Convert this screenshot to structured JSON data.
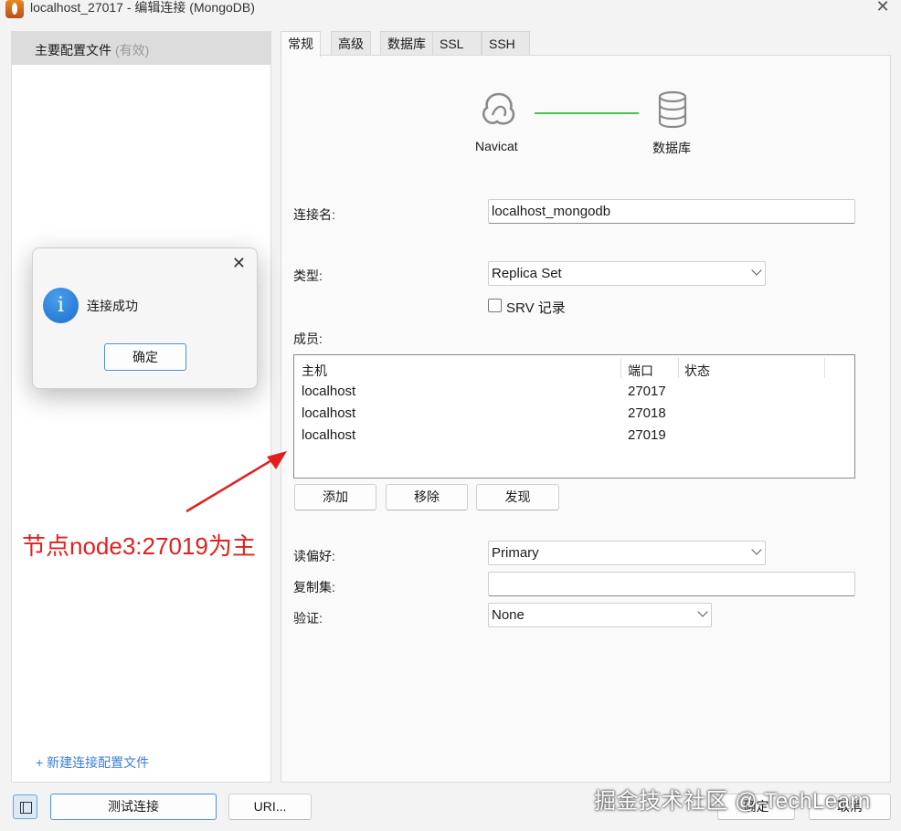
{
  "window": {
    "title": "localhost_27017 - 编辑连接 (MongoDB)"
  },
  "sidebar": {
    "profile_label": "主要配置文件",
    "profile_status": "(有效)",
    "new_profile_link": "+ 新建连接配置文件"
  },
  "tabs": [
    "常规",
    "高级",
    "数据库",
    "SSL",
    "SSH"
  ],
  "diagram": {
    "left_label": "Navicat",
    "right_label": "数据库",
    "line_color": "#4cc04c"
  },
  "form": {
    "connection_name_label": "连接名:",
    "connection_name_value": "localhost_mongodb",
    "type_label": "类型:",
    "type_value": "Replica Set",
    "srv_label": "SRV 记录",
    "members_label": "成员:",
    "members_columns": [
      "主机",
      "端口",
      "状态"
    ],
    "members": [
      {
        "host": "localhost",
        "port": "27017",
        "status": ""
      },
      {
        "host": "localhost",
        "port": "27018",
        "status": ""
      },
      {
        "host": "localhost",
        "port": "27019",
        "status": ""
      }
    ],
    "add_button": "添加",
    "remove_button": "移除",
    "discover_button": "发现",
    "read_pref_label": "读偏好:",
    "read_pref_value": "Primary",
    "replica_set_label": "复制集:",
    "replica_set_value": "",
    "auth_label": "验证:",
    "auth_value": "None"
  },
  "bottom": {
    "test_button": "测试连接",
    "uri_button": "URI...",
    "ok_button": "确定",
    "cancel_button": "取消",
    "watermark": "掘金技术社区 @ TechLearn"
  },
  "dialog": {
    "message": "连接成功",
    "ok_button": "确定"
  },
  "annotation": {
    "text": "节点node3:27019为主",
    "color": "#e02020"
  }
}
